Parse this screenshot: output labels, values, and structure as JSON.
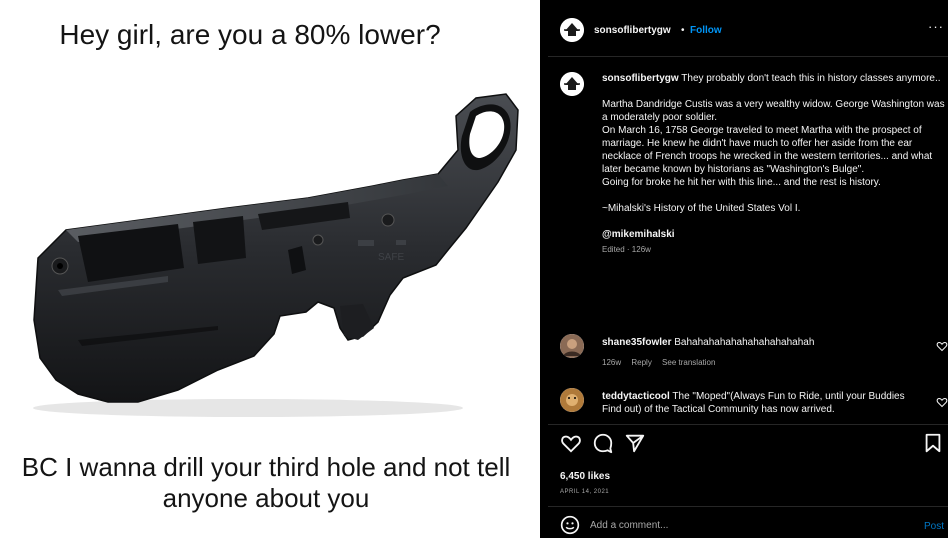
{
  "meme": {
    "top_text": "Hey girl, are you a 80% lower?",
    "bottom_text": "BC I wanna drill your third hole and not tell anyone about you"
  },
  "post": {
    "username": "sonsoflibertygw",
    "separator": "•",
    "follow_label": "Follow",
    "more_label": "···",
    "caption": {
      "username": "sonsoflibertygw",
      "intro": "They probably don't teach this in history classes anymore..",
      "paragraph": "Martha Dandridge Custis was a very wealthy widow. George Washington was a moderately poor soldier.\nOn March 16, 1758 George traveled to meet Martha with the prospect of marriage. He knew he didn't have much to offer her aside from the ear necklace of French troops he wrecked in the western territories... and what later became known by historians as \"Washington's Bulge\".\nGoing for broke he hit her with this line... and the rest is history.",
      "attribution": "~Mihalski's History of the United States Vol I.",
      "mention": "@mikemihalski",
      "edited": "Edited · 126w"
    },
    "comments": [
      {
        "username": "shane35fowler",
        "text": "Bahahahahahahahahahahahah",
        "age": "126w",
        "reply_label": "Reply",
        "translate_label": "See translation"
      },
      {
        "username": "teddytacticool",
        "text": "The \"Moped\"(Always Fun to Ride, until your Buddies Find out) of the Tactical Community has now arrived."
      }
    ],
    "likes": "6,450 likes",
    "date": "APRIL 14, 2021",
    "comment_placeholder": "Add a comment...",
    "post_label": "Post"
  },
  "icons": {
    "post_avatar": "spartan-helmet-logo",
    "like": "heart-icon",
    "comment": "comment-bubble-icon",
    "share": "paper-plane-icon",
    "save": "bookmark-icon",
    "emoji": "smiley-icon"
  },
  "colors": {
    "accent": "#0095f6",
    "panel_bg": "#000000",
    "muted_text": "#a8a8a8",
    "meme_bg": "#ffffff"
  }
}
